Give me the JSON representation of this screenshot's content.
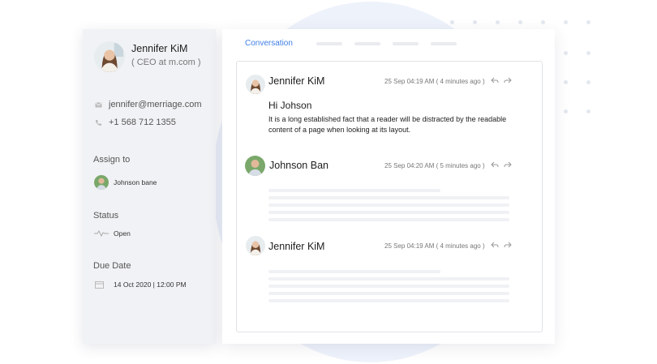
{
  "sidebar": {
    "contact": {
      "name": "Jennifer KiM",
      "title": "( CEO at m.com )"
    },
    "email": "jennifer@merriage.com",
    "phone": "+1 568 712 1355",
    "assign": {
      "label": "Assign to",
      "value": "Johnson bane"
    },
    "status": {
      "label": "Status",
      "value": "Open"
    },
    "due": {
      "label": "Due Date",
      "value": "14 Oct 2020 | 12:00 PM"
    }
  },
  "main": {
    "active_tab": "Conversation",
    "messages": [
      {
        "author": "Jennifer KiM",
        "meta": "25 Sep 04:19 AM ( 4 minutes ago )",
        "greeting": "Hi Johson",
        "body": "It is a long established fact that a reader will be distracted by the readable content of a page when looking at its layout."
      },
      {
        "author": "Johnson Ban",
        "meta": "25 Sep 04:20 AM ( 5 minutes ago )"
      },
      {
        "author": "Jennifer KiM",
        "meta": "25 Sep 04:19 AM ( 4 minutes ago )"
      }
    ]
  },
  "colors": {
    "accent": "#3f7fe6",
    "sidebar_bg": "#f1f2f5",
    "background_blob": "#eef2fb"
  },
  "icons": [
    "mail-icon",
    "phone-icon",
    "pulse-icon",
    "calendar-icon",
    "reply-icon",
    "forward-icon"
  ]
}
